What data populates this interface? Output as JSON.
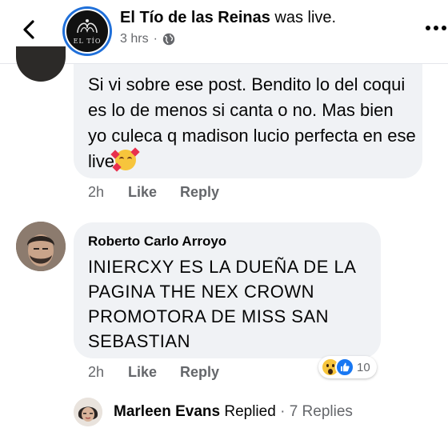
{
  "header": {
    "page_name": "El Tío de las Reinas",
    "action": " was live.",
    "time": "3 hrs",
    "separator": "·",
    "avatar_text": "EL TÍO",
    "back_icon": "chevron-left-icon",
    "privacy_icon": "globe-icon",
    "more_icon": "more-dots-icon"
  },
  "comments": [
    {
      "text": "Si vi sobre ese post. Bendito lo del coqui es lo de menos si canta o no. Mas bien yo culeca q madison lucio perfecta en ese live",
      "emoji": "smiling-face-with-hearts-icon",
      "time": "2h",
      "like_label": "Like",
      "reply_label": "Reply"
    },
    {
      "author": "Roberto Carlo Arroyo",
      "text": "INIERCXY ES LA DUEÑA DE LA PAGINA  THE NEX CROWN PROMOTORA DE MISS SAN SEBASTIAN",
      "time": "2h",
      "like_label": "Like",
      "reply_label": "Reply",
      "reactions": {
        "types": [
          "wow-reaction-icon",
          "like-reaction-icon"
        ],
        "count": "10"
      }
    }
  ],
  "reply_summary": {
    "name": "Marleen Evans",
    "action": " Replied",
    "separator": " · ",
    "count": "7 Replies"
  },
  "colors": {
    "accent": "#1877f2",
    "bubble": "#f0f2f5",
    "secondary_text": "#65676b"
  }
}
